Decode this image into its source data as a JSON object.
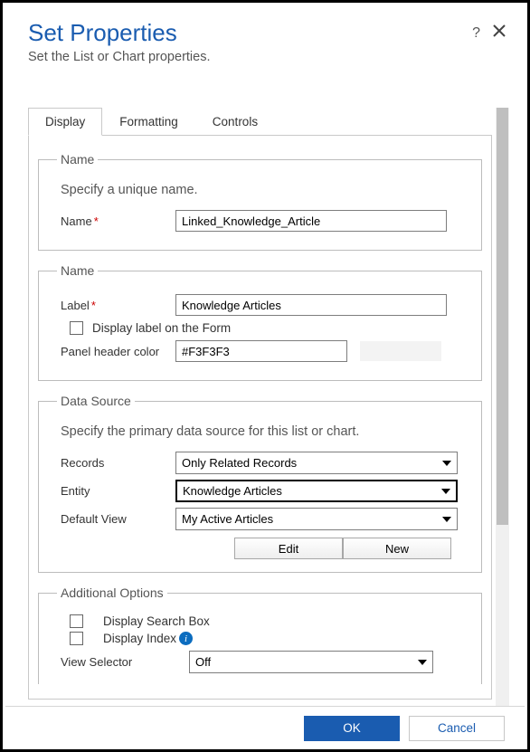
{
  "header": {
    "title": "Set Properties",
    "subtitle": "Set the List or Chart properties."
  },
  "tabs": {
    "display": "Display",
    "formatting": "Formatting",
    "controls": "Controls"
  },
  "group_name1": {
    "legend": "Name",
    "desc": "Specify a unique name.",
    "name_label": "Name",
    "name_value": "Linked_Knowledge_Article"
  },
  "group_name2": {
    "legend": "Name",
    "label_label": "Label",
    "label_value": "Knowledge Articles",
    "display_label_chk": "Display label on the Form",
    "panel_color_label": "Panel header color",
    "panel_color_value": "#F3F3F3"
  },
  "group_ds": {
    "legend": "Data Source",
    "desc": "Specify the primary data source for this list or chart.",
    "records_label": "Records",
    "records_value": "Only Related Records",
    "entity_label": "Entity",
    "entity_value": "Knowledge Articles",
    "view_label": "Default View",
    "view_value": "My Active Articles",
    "edit_btn": "Edit",
    "new_btn": "New"
  },
  "group_opts": {
    "legend": "Additional Options",
    "search_chk": "Display Search Box",
    "index_chk": "Display Index",
    "view_sel_label": "View Selector",
    "view_sel_value": "Off"
  },
  "footer": {
    "ok": "OK",
    "cancel": "Cancel"
  }
}
